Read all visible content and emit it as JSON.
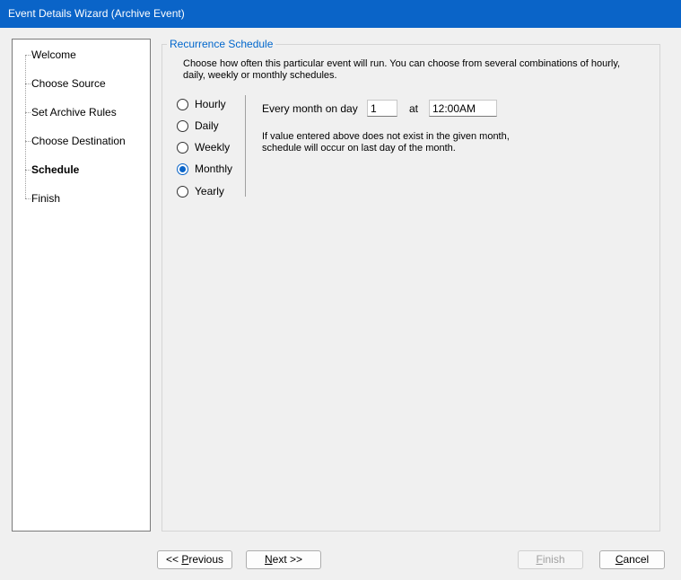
{
  "window": {
    "title": "Event Details Wizard (Archive Event)"
  },
  "steps": [
    {
      "label": "Welcome"
    },
    {
      "label": "Choose Source"
    },
    {
      "label": "Set Archive Rules"
    },
    {
      "label": "Choose Destination"
    },
    {
      "label": "Schedule",
      "current": true
    },
    {
      "label": "Finish"
    }
  ],
  "schedule": {
    "group_title": "Recurrence Schedule",
    "description": "Choose how often this particular event will run. You can choose from several combinations of hourly, daily, weekly or monthly schedules.",
    "options": [
      {
        "label": "Hourly",
        "checked": false
      },
      {
        "label": "Daily",
        "checked": false
      },
      {
        "label": "Weekly",
        "checked": false
      },
      {
        "label": "Monthly",
        "checked": true
      },
      {
        "label": "Yearly",
        "checked": false
      }
    ],
    "monthly": {
      "day_label": "Every month on day",
      "day_value": "1",
      "at_label": "at",
      "time_value": "12:00AM",
      "note_line1": "If value entered above does not exist in the given month,",
      "note_line2": "schedule will occur on last day of the month."
    }
  },
  "buttons": {
    "previous_prefix": "<< ",
    "previous_mnemonic": "P",
    "previous_rest": "revious",
    "next_mnemonic": "N",
    "next_rest": "ext >>",
    "finish_mnemonic": "F",
    "finish_rest": "inish",
    "cancel_mnemonic": "C",
    "cancel_rest": "ancel"
  },
  "colors": {
    "titlebar": "#0a64c8",
    "group_title": "#0066cc",
    "radio_checked": "#0a64c8"
  }
}
